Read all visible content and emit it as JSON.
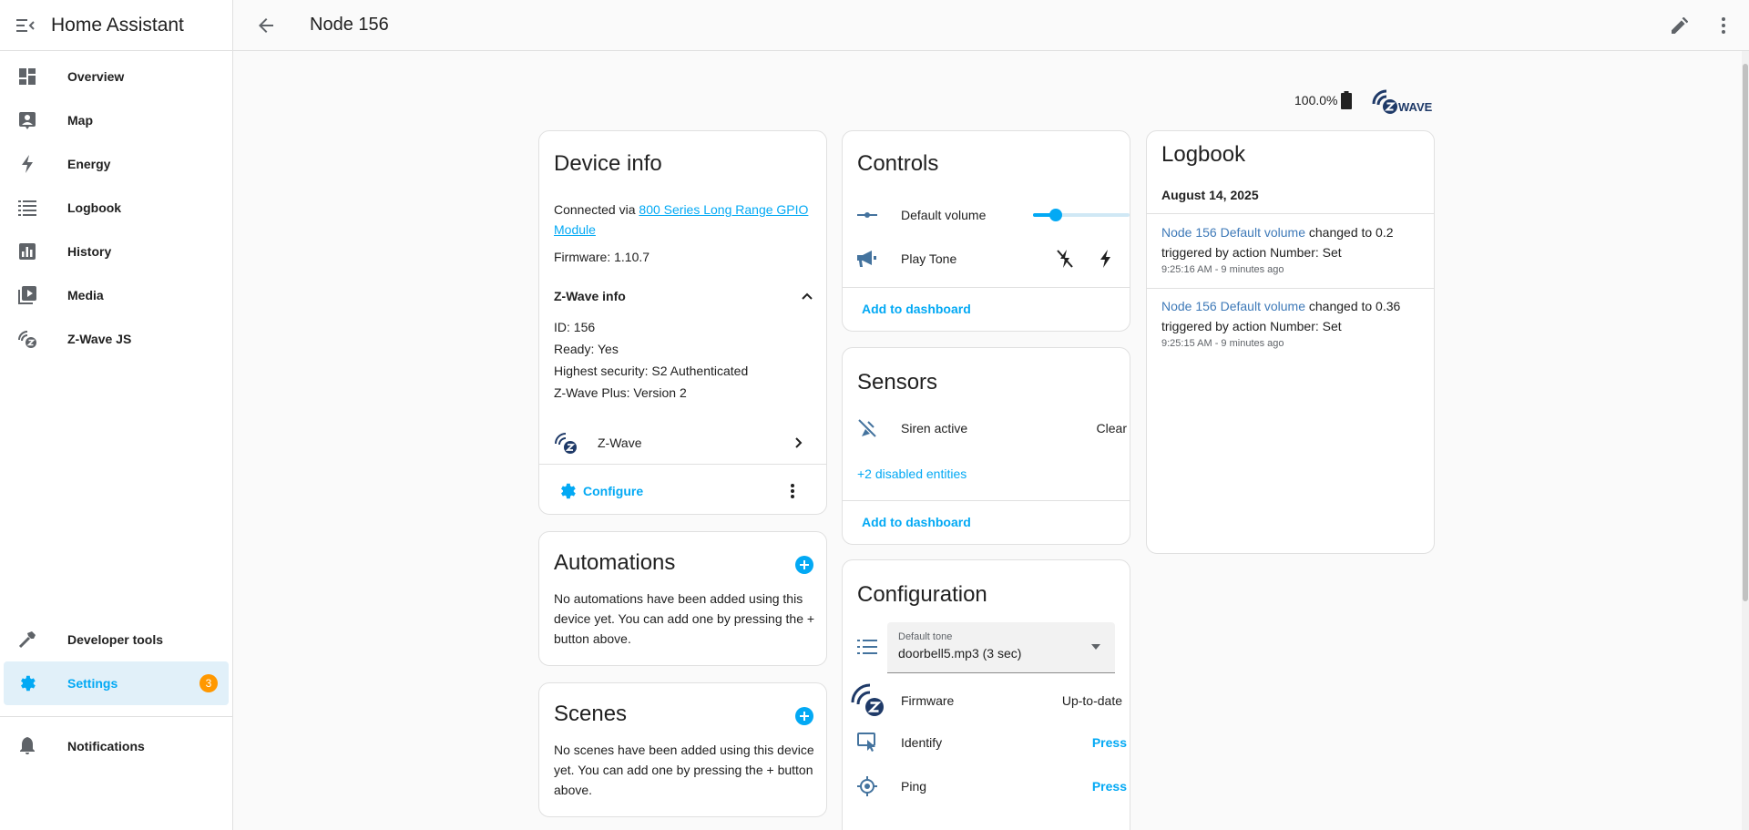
{
  "app": {
    "title": "Home Assistant"
  },
  "sidebar": {
    "items": [
      {
        "label": "Overview",
        "icon": "dashboard-icon"
      },
      {
        "label": "Map",
        "icon": "map-icon"
      },
      {
        "label": "Energy",
        "icon": "lightning-icon"
      },
      {
        "label": "Logbook",
        "icon": "list-icon"
      },
      {
        "label": "History",
        "icon": "chart-icon"
      },
      {
        "label": "Media",
        "icon": "media-icon"
      },
      {
        "label": "Z-Wave JS",
        "icon": "zwave-icon"
      }
    ],
    "developer_tools": "Developer tools",
    "settings": "Settings",
    "settings_badge": "3",
    "notifications": "Notifications"
  },
  "topbar": {
    "title": "Node 156"
  },
  "header": {
    "battery": "100.0%"
  },
  "device_info": {
    "title": "Device info",
    "connected_prefix": "Connected via ",
    "connected_link": "800 Series Long Range GPIO Module",
    "firmware": "Firmware: 1.10.7",
    "zwave_info_title": "Z-Wave info",
    "id": "ID: 156",
    "ready": "Ready: Yes",
    "security": "Highest security: S2 Authenticated",
    "plus": "Z-Wave Plus: Version 2",
    "integration": "Z-Wave",
    "configure": "Configure"
  },
  "automations": {
    "title": "Automations",
    "text": "No automations have been added using this device yet. You can add one by pressing the + button above."
  },
  "scenes": {
    "title": "Scenes",
    "text": "No scenes have been added using this device yet. You can add one by pressing the + button above."
  },
  "controls": {
    "title": "Controls",
    "volume_label": "Default volume",
    "volume_value": 0.12,
    "tone_label": "Play Tone",
    "add_to_dashboard": "Add to dashboard"
  },
  "sensors": {
    "title": "Sensors",
    "siren_label": "Siren active",
    "siren_state": "Clear",
    "disabled_entities": "+2 disabled entities",
    "add_to_dashboard": "Add to dashboard"
  },
  "configuration": {
    "title": "Configuration",
    "tone_field_label": "Default tone",
    "tone_field_value": "doorbell5.mp3 (3 sec)",
    "firmware_label": "Firmware",
    "firmware_state": "Up-to-date",
    "identify_label": "Identify",
    "identify_action": "Press",
    "ping_label": "Ping",
    "ping_action": "Press"
  },
  "logbook": {
    "title": "Logbook",
    "date": "August 14, 2025",
    "entries": [
      {
        "entity": "Node 156 Default volume",
        "text": " changed to 0.2 triggered by action Number: Set",
        "time": "9:25:16 AM - 9 minutes ago"
      },
      {
        "entity": "Node 156 Default volume",
        "text": " changed to 0.36 triggered by action Number: Set",
        "time": "9:25:15 AM - 9 minutes ago"
      }
    ]
  },
  "colors": {
    "accent": "#03a9f4",
    "badge": "#ff9800",
    "zwave_blue": "#1f3a68"
  }
}
